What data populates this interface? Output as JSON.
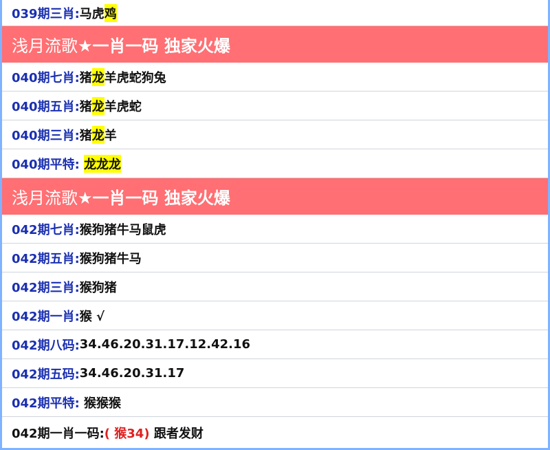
{
  "rows": [
    {
      "type": "pred",
      "label": "039期三肖:",
      "pre": "马虎",
      "hl": "鸡",
      "post": ""
    },
    {
      "type": "header",
      "title_a": "浅月流歌★",
      "title_b": "一肖一码 独家火爆"
    },
    {
      "type": "pred",
      "label": "040期七肖:",
      "pre": "猪",
      "hl": "龙",
      "post": "羊虎蛇狗兔"
    },
    {
      "type": "pred",
      "label": "040期五肖:",
      "pre": "猪",
      "hl": "龙",
      "post": "羊虎蛇"
    },
    {
      "type": "pred",
      "label": "040期三肖:",
      "pre": "猪",
      "hl": "龙",
      "post": "羊"
    },
    {
      "type": "pred",
      "label": "040期平特:",
      "pre": " ",
      "hl": "龙龙龙",
      "post": ""
    },
    {
      "type": "header",
      "title_a": "浅月流歌★",
      "title_b": "一肖一码 独家火爆"
    },
    {
      "type": "pred",
      "label": "042期七肖:",
      "pre": "猴狗猪牛马鼠虎",
      "hl": "",
      "post": ""
    },
    {
      "type": "pred",
      "label": "042期五肖:",
      "pre": "猴狗猪牛马",
      "hl": "",
      "post": ""
    },
    {
      "type": "pred",
      "label": "042期三肖:",
      "pre": "猴狗猪",
      "hl": "",
      "post": ""
    },
    {
      "type": "pred",
      "label": "042期一肖:",
      "pre": "猴 √",
      "hl": "",
      "post": ""
    },
    {
      "type": "pred",
      "label": "042期八码:",
      "pre": "34.46.20.31.17.12.42.16",
      "hl": "",
      "post": ""
    },
    {
      "type": "pred",
      "label": "042期五码:",
      "pre": "34.46.20.31.17",
      "hl": "",
      "post": ""
    },
    {
      "type": "pred",
      "label": "042期平特:",
      "pre": " 猴猴猴",
      "hl": "",
      "post": ""
    },
    {
      "type": "final",
      "label": "042期一肖一码:",
      "red": "( 猴34)",
      "post": " 跟者发财"
    }
  ],
  "colors": {
    "label_blue": "#1a2fb0",
    "header_red": "#ff6f73",
    "highlight_yellow": "#ffff00",
    "accent_red": "#e02020",
    "frame_blue": "#7fb3ff"
  }
}
